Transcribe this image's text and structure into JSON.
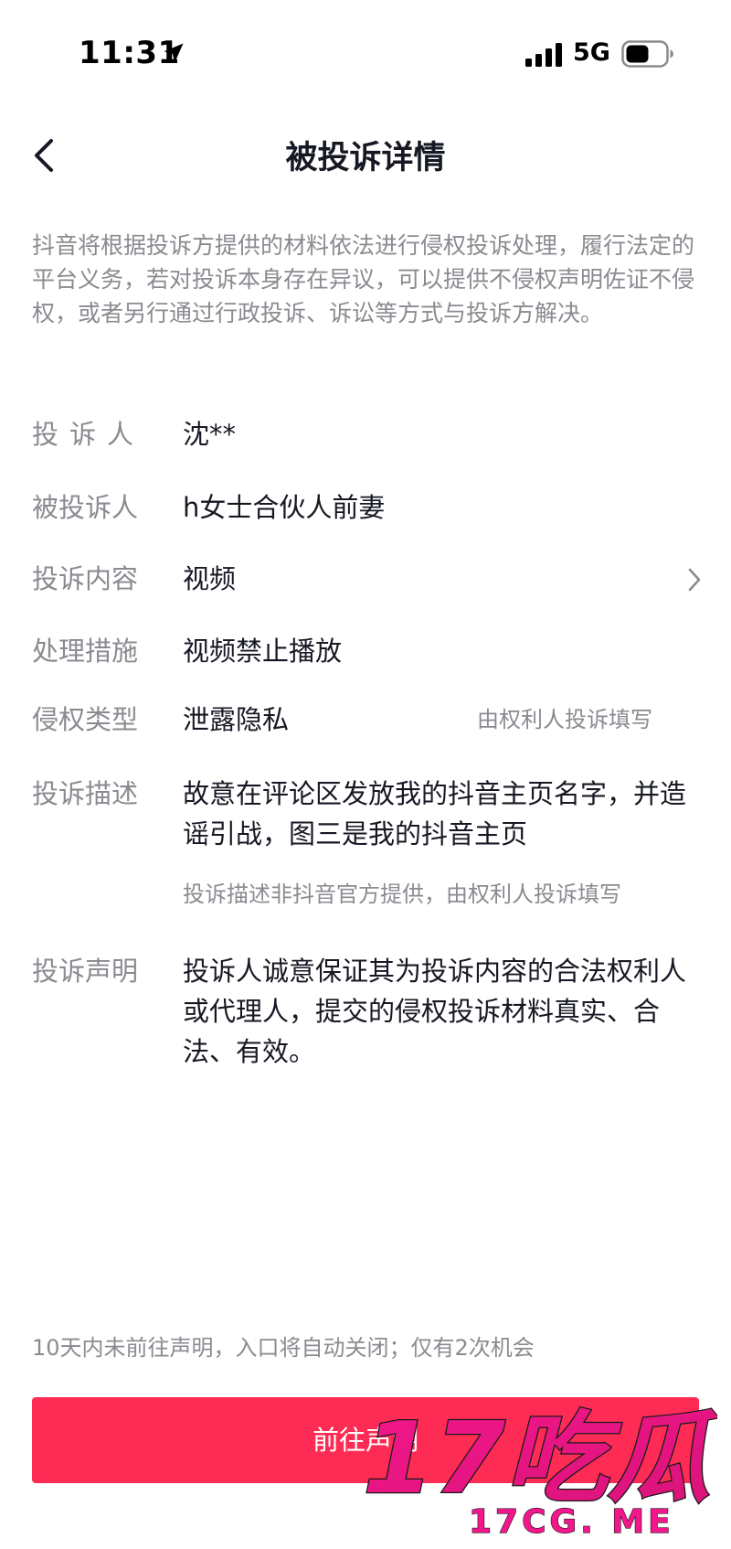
{
  "status_bar": {
    "time": "11:31",
    "network": "5G"
  },
  "nav": {
    "title": "被投诉详情"
  },
  "intro": "抖音将根据投诉方提供的材料依法进行侵权投诉处理，履行法定的平台义务，若对投诉本身存在异议，可以提供不侵权声明佐证不侵权，或者另行通过行政投诉、诉讼等方式与投诉方解决。",
  "details": {
    "complainant": {
      "label": "投诉人",
      "value": "沈**"
    },
    "respondent": {
      "label": "被投诉人",
      "value": "h女士合伙人前妻"
    },
    "content": {
      "label": "投诉内容",
      "value": "视频"
    },
    "action": {
      "label": "处理措施",
      "value": "视频禁止播放"
    },
    "infringement_type": {
      "label": "侵权类型",
      "value": "泄露隐私",
      "note": "由权利人投诉填写"
    },
    "description": {
      "label": "投诉描述",
      "value": "故意在评论区发放我的抖音主页名字，并造谣引战，图三是我的抖音主页",
      "note": "投诉描述非抖音官方提供，由权利人投诉填写"
    },
    "statement": {
      "label": "投诉声明",
      "value": "投诉人诚意保证其为投诉内容的合法权利人或代理人，提交的侵权投诉材料真实、合法、有效。"
    }
  },
  "footer": {
    "deadline_note": "10天内未前往声明，入口将自动关闭；仅有2次机会",
    "button_label": "前往声明"
  },
  "watermark": {
    "big_text": "17吃瓜",
    "small_text": "17CG. ME"
  },
  "colors": {
    "accent": "#fe2c55",
    "watermark": "#e8197a",
    "muted_text": "#8a8b91",
    "primary_text": "#161823"
  }
}
